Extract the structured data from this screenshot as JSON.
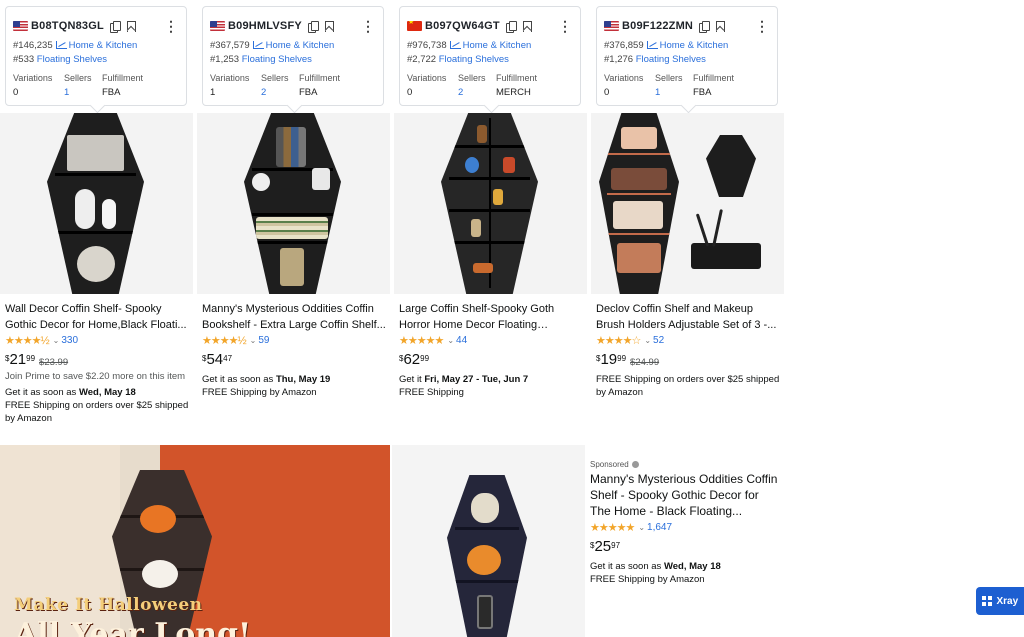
{
  "products": [
    {
      "flag": "us",
      "asin": "B08TQN83GL",
      "bsr_main": "#146,235",
      "category": "Home & Kitchen",
      "bsr_sub": "#533",
      "subcategory": "Floating Shelves",
      "variations_label": "Variations",
      "variations": "0",
      "sellers_label": "Sellers",
      "sellers": "1",
      "fulfillment_label": "Fulfillment",
      "fulfillment": "FBA",
      "title": "Wall Decor Coffin Shelf- Spooky Gothic Decor for Home,Black Floati...",
      "stars": "★★★★½",
      "review_count": "330",
      "price_symbol": "$",
      "price_whole": "21",
      "price_fraction": "99",
      "price_old": "$23.99",
      "line1": "Join Prime to save $2.20 more on this item",
      "delivery_prefix": "Get it as soon as ",
      "delivery_date": "Wed, May 18",
      "shipping": "FREE Shipping on orders over $25 shipped by Amazon"
    },
    {
      "flag": "us",
      "asin": "B09HMLVSFY",
      "bsr_main": "#367,579",
      "category": "Home & Kitchen",
      "bsr_sub": "#1,253",
      "subcategory": "Floating Shelves",
      "variations_label": "Variations",
      "variations": "1",
      "sellers_label": "Sellers",
      "sellers": "2",
      "fulfillment_label": "Fulfillment",
      "fulfillment": "FBA",
      "title": "Manny's Mysterious Oddities Coffin Bookshelf - Extra Large Coffin Shelf...",
      "stars": "★★★★½",
      "review_count": "59",
      "price_symbol": "$",
      "price_whole": "54",
      "price_fraction": "47",
      "price_old": "",
      "delivery_prefix": "Get it as soon as ",
      "delivery_date": "Thu, May 19",
      "shipping": "FREE Shipping by Amazon"
    },
    {
      "flag": "cn",
      "asin": "B097QW64GT",
      "bsr_main": "#976,738",
      "category": "Home & Kitchen",
      "bsr_sub": "#2,722",
      "subcategory": "Floating Shelves",
      "variations_label": "Variations",
      "variations": "0",
      "sellers_label": "Sellers",
      "sellers": "2",
      "fulfillment_label": "Fulfillment",
      "fulfillment": "MERCH",
      "title": "Large Coffin Shelf-Spooky Goth Horror Home Decor Floating Woode...",
      "stars": "★★★★★",
      "review_count": "44",
      "price_symbol": "$",
      "price_whole": "62",
      "price_fraction": "99",
      "price_old": "",
      "delivery_prefix": "Get it ",
      "delivery_date": "Fri, May 27 - Tue, Jun 7",
      "shipping": "FREE Shipping"
    },
    {
      "flag": "us",
      "asin": "B09F122ZMN",
      "bsr_main": "#376,859",
      "category": "Home & Kitchen",
      "bsr_sub": "#1,276",
      "subcategory": "Floating Shelves",
      "variations_label": "Variations",
      "variations": "0",
      "sellers_label": "Sellers",
      "sellers": "1",
      "fulfillment_label": "Fulfillment",
      "fulfillment": "FBA",
      "title": "Declov Coffin Shelf and Makeup Brush Holders Adjustable Set of 3 -...",
      "stars": "★★★★☆",
      "review_count": "52",
      "price_symbol": "$",
      "price_whole": "19",
      "price_fraction": "99",
      "price_old": "$24.99",
      "line1": "FREE Shipping on orders over $25 shipped by Amazon"
    }
  ],
  "banner": {
    "line1": "Make It Halloween",
    "line2": "All Year Long!"
  },
  "sponsored": {
    "label": "Sponsored",
    "title": "Manny's Mysterious Oddities Coffin Shelf - Spooky Gothic Decor for The Home - Black Floating...",
    "stars": "★★★★★",
    "review_count": "1,647",
    "price_symbol": "$",
    "price_whole": "25",
    "price_fraction": "97",
    "delivery_prefix": "Get it as soon as ",
    "delivery_date": "Wed, May 18",
    "shipping": "FREE Shipping by Amazon"
  },
  "xray": {
    "label": "Xray"
  },
  "colors": {
    "accent": "#2a6fdb",
    "star": "#f2a52a",
    "xray": "#1d5fd1",
    "banner_orange": "#d2542a"
  },
  "icons": [
    "us-flag-icon",
    "cn-flag-icon",
    "copy-icon",
    "bookmark-icon",
    "more-vertical-icon",
    "trend-chart-icon",
    "info-icon",
    "grid-icon"
  ]
}
